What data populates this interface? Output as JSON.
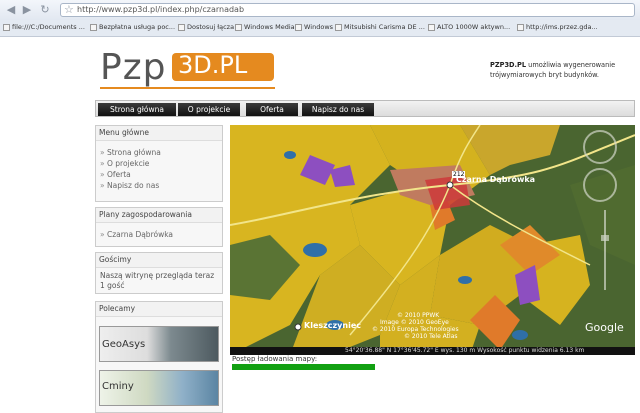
{
  "browser": {
    "url": "http://www.pzp3d.pl/index.php/czarnadab",
    "bookmarks": [
      "file:///C:/Documents ...",
      "Bezpłatna usługa poc...",
      "Dostosuj łącza",
      "Windows Media",
      "Windows",
      "Mitsubishi Carisma DE ...",
      "ALTO 1000W aktywn...",
      "http://ims.przez.gda..."
    ]
  },
  "logo": {
    "left": "Pzp",
    "right": "3D.PL"
  },
  "tagline": {
    "brand": "PZP3D.PL",
    "text": " umożliwia wygenerowanie trójwymiarowych bryt budynków."
  },
  "menu": [
    "Strona główna",
    "O projekcie",
    "Oferta",
    "Napisz do nas"
  ],
  "sidebar": {
    "main_menu": {
      "title": "Menu główne",
      "items": [
        "Strona główna",
        "O projekcie",
        "Oferta",
        "Napisz do nas"
      ]
    },
    "plans": {
      "title": "Plany zagospodarowania",
      "items": [
        "Czarna Dąbrówka"
      ]
    },
    "guests": {
      "title": "Gościmy",
      "text": "Naszą witrynę przegląda teraz 1 gość"
    },
    "recommended": {
      "title": "Polecamy",
      "banners": [
        "GeoAsys",
        "Cminy"
      ]
    }
  },
  "map": {
    "places": [
      "Czarna Dąbrówka",
      "Kleszczyniec"
    ],
    "road_label": "212",
    "copyright": [
      "© 2010 PPWK",
      "Image © 2010 GeoEye",
      "© 2010 Europa Technologies",
      "© 2010 Tele Atlas"
    ],
    "status": "54°20'36.88\" N   17°36'45.72\" E   wys.  130 m   Wysokość punktu widzenia  6.13 km",
    "google": "Google"
  },
  "loading": {
    "label": "Postęp ładowania mapy:",
    "progress": 0.35
  },
  "colors": {
    "accent": "#e58a1f",
    "zone_yellow": "#d8b520",
    "forest": "#4a6530",
    "loadbar": "#12a012"
  }
}
